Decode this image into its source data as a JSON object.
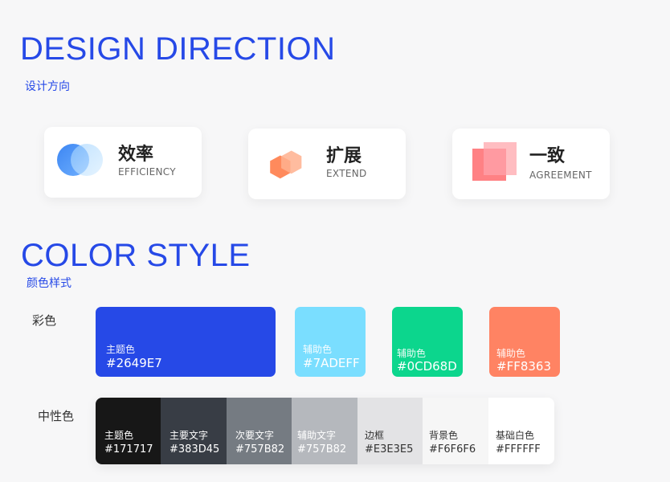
{
  "design": {
    "title": "DESIGN DIRECTION",
    "subtitle": "设计方向",
    "cards": [
      {
        "cn": "效率",
        "en": "EFFICIENCY",
        "icon": "overlapping-circles-icon"
      },
      {
        "cn": "扩展",
        "en": "EXTEND",
        "icon": "overlapping-hexagons-icon"
      },
      {
        "cn": "一致",
        "en": "AGREEMENT",
        "icon": "overlapping-squares-icon"
      }
    ]
  },
  "color": {
    "title": "COLOR STYLE",
    "subtitle": "颜色样式",
    "primary_label": "彩色",
    "neutral_label": "中性色",
    "primary": [
      {
        "name": "主题色",
        "hex": "#2649E7",
        "color": "#2649E7"
      },
      {
        "name": "辅助色",
        "hex": "#7ADEFF",
        "color": "#7ADEFF"
      },
      {
        "name": "辅助色",
        "hex": "#0CD68D",
        "color": "#0CD68D"
      },
      {
        "name": "辅助色",
        "hex": "#FF8363",
        "color": "#FF8363"
      }
    ],
    "neutral": [
      {
        "name": "主题色",
        "hex": "#171717",
        "color": "#171717",
        "text": "#FFFFFF"
      },
      {
        "name": "主要文字",
        "hex": "#383D45",
        "color": "#383D45",
        "text": "#FFFFFF"
      },
      {
        "name": "次要文字",
        "hex": "#757B82",
        "color": "#757B82",
        "text": "#FFFFFF"
      },
      {
        "name": "辅助文字",
        "hex": "#757B82",
        "color": "#B5B8BD",
        "text": "#FFFFFF"
      },
      {
        "name": "边框",
        "hex": "#E3E3E5",
        "color": "#E3E3E5",
        "text": "#333333"
      },
      {
        "name": "背景色",
        "hex": "#F6F6F6",
        "color": "#F6F6F6",
        "text": "#333333"
      },
      {
        "name": "基础白色",
        "hex": "#FFFFFF",
        "color": "#FFFFFF",
        "text": "#333333"
      }
    ]
  }
}
